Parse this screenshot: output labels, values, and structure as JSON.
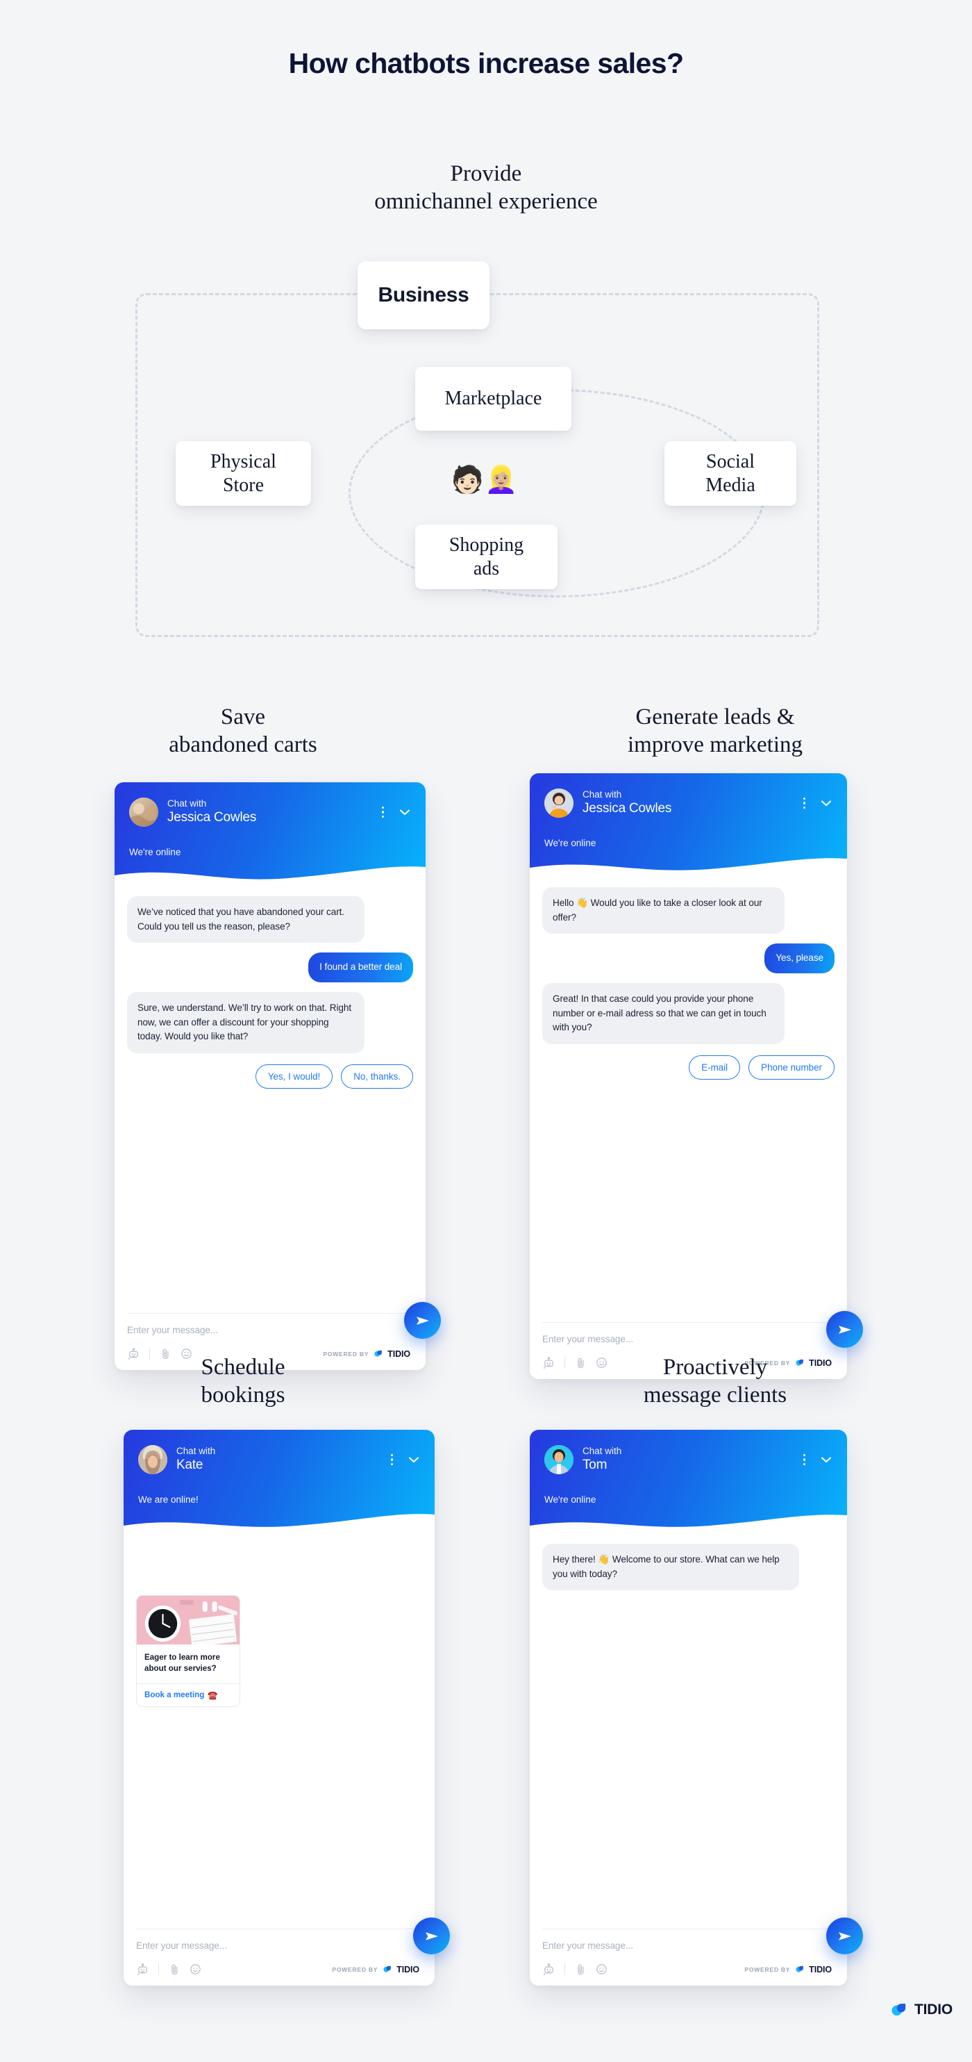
{
  "headline": "How chatbots increase sales?",
  "omnichannel": {
    "title": "Provide\nomnichannel experience",
    "nodes": {
      "business": "Business",
      "marketplace": "Marketplace",
      "physical_store": "Physical\nStore",
      "social_media": "Social\nMedia",
      "shopping_ads": "Shopping\nads"
    },
    "people_emoji": "🧑🏻👱🏼‍♀️"
  },
  "colors": {
    "page_bg": "#f4f5f7",
    "brand_blue": "#1f7bf4",
    "gradient_start": "#2639df",
    "gradient_end": "#07b4fb",
    "bot_bubble": "#eef0f3",
    "text_dark": "#12182e",
    "dash_border": "#d2d9e4"
  },
  "common": {
    "chat_with_label": "Chat with",
    "composer_placeholder": "Enter your message...",
    "powered_by": "POWERED BY",
    "tidio_word": "TIDIO",
    "icons": {
      "kebab": "kebab-menu-icon",
      "chevron": "chevron-down-icon",
      "bot": "bot-icon",
      "attach": "paperclip-icon",
      "emoji": "smiley-icon",
      "send": "send-icon"
    }
  },
  "widgets": [
    {
      "id": "save-abandoned-carts",
      "section_title": "Save\nabandoned carts",
      "agent": "Jessica Cowles",
      "status": "We're online",
      "messages": [
        {
          "from": "bot",
          "text": "We’ve noticed that you have abandoned your cart. Could you tell us the reason, please?"
        },
        {
          "from": "user",
          "text": "I found a better deal"
        },
        {
          "from": "bot",
          "text": "Sure, we understand. We’ll try to work on that. Right now, we can offer a discount for your shopping today. Would you like that?"
        }
      ],
      "quick_replies": [
        "Yes, I would!",
        "No, thanks."
      ]
    },
    {
      "id": "generate-leads",
      "section_title": "Generate leads &\nimprove marketing",
      "agent": "Jessica Cowles",
      "status": "We're online",
      "messages": [
        {
          "from": "bot",
          "text": "Hello 👋 Would you like to take a closer look at our offer?"
        },
        {
          "from": "user",
          "text": "Yes, please"
        },
        {
          "from": "bot",
          "text": "Great! In that case could you provide your phone number or e-mail adress so that we can get in touch with you?"
        }
      ],
      "quick_replies": [
        "E-mail",
        "Phone number"
      ]
    },
    {
      "id": "schedule-bookings",
      "section_title": "Schedule\nbookings",
      "agent": "Kate",
      "status": "We are online!",
      "messages": [],
      "quick_replies": [],
      "card": {
        "text": "Eager to learn more about our servies?",
        "cta": "Book a meeting",
        "cta_emoji": "☎️"
      }
    },
    {
      "id": "proactively-message-clients",
      "section_title": "Proactively\nmessage clients",
      "agent": "Tom",
      "status": "We're online",
      "messages": [
        {
          "from": "bot",
          "text": "Hey there! 👋 Welcome to our store. What can we help you with today?"
        }
      ],
      "quick_replies": []
    }
  ],
  "footer_brand": {
    "word": "TIDIO"
  }
}
